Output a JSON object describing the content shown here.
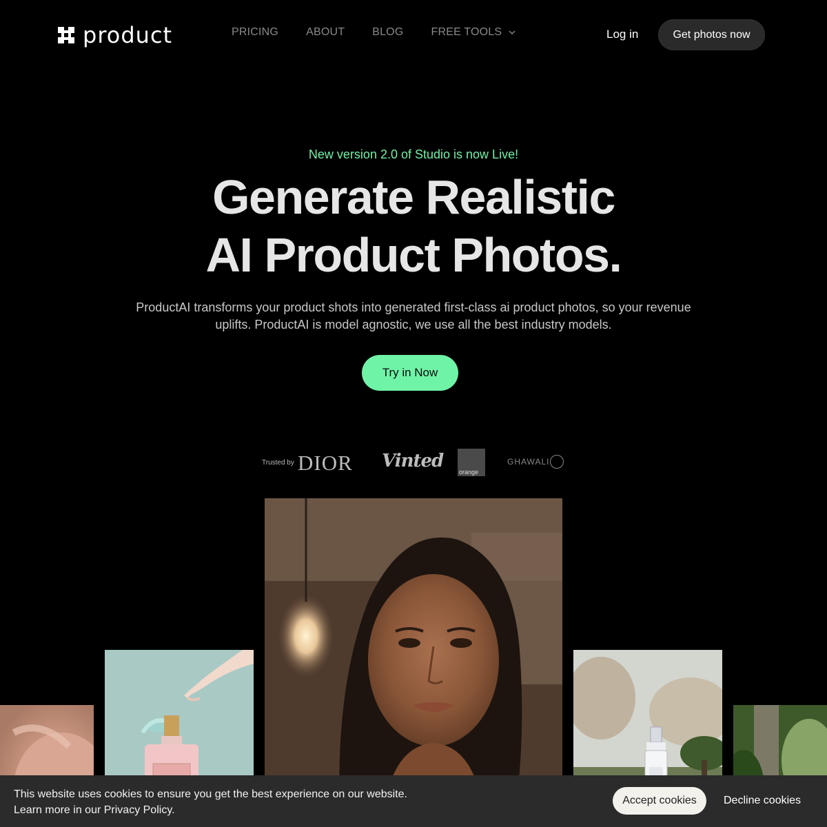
{
  "brand": {
    "logo_text": "product"
  },
  "nav": {
    "items": [
      {
        "label": "PRICING"
      },
      {
        "label": "ABOUT"
      },
      {
        "label": "BLOG"
      },
      {
        "label": "FREE TOOLS"
      }
    ],
    "login_label": "Log in",
    "cta_label": "Get photos now"
  },
  "hero": {
    "announcement": "New version 2.0 of Studio is now Live!",
    "headline_line1": "Generate Realistic",
    "headline_line2": "AI Product Photos.",
    "subcopy": "ProductAI transforms your product shots into generated first-class ai product photos, so your revenue uplifts. ProductAI is model agnostic, we use all the best industry models.",
    "cta_label": "Try in Now"
  },
  "trusted": {
    "label": "Trusted by",
    "logos": [
      "DIOR",
      "Vinted",
      "orange",
      "GHAWALI"
    ]
  },
  "gallery": {
    "images": [
      "hand-photo",
      "perfume-photo",
      "portrait-photo",
      "spray-bottle-photo",
      "garden-photo"
    ]
  },
  "cookie": {
    "line1": "This website uses cookies to ensure you get the best experience on our website.",
    "line2": "Learn more in our Privacy Policy.",
    "accept_label": "Accept cookies",
    "decline_label": "Decline cookies"
  },
  "colors": {
    "accent_green": "#6ff3a7",
    "background": "#000000",
    "cookie_bar": "#2b2b2b"
  }
}
